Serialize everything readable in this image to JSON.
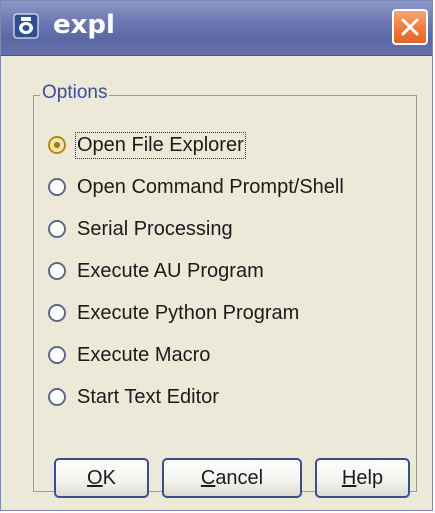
{
  "window": {
    "title": "expl"
  },
  "group": {
    "label": "Options"
  },
  "options": [
    {
      "label": "Open File Explorer",
      "selected": true
    },
    {
      "label": "Open Command Prompt/Shell",
      "selected": false
    },
    {
      "label": "Serial Processing",
      "selected": false
    },
    {
      "label": "Execute AU Program",
      "selected": false
    },
    {
      "label": "Execute Python Program",
      "selected": false
    },
    {
      "label": "Execute Macro",
      "selected": false
    },
    {
      "label": "Start Text Editor",
      "selected": false
    }
  ],
  "buttons": {
    "ok": {
      "mnemonic": "O",
      "rest": "K"
    },
    "cancel": {
      "mnemonic": "C",
      "rest": "ancel"
    },
    "help": {
      "mnemonic": "H",
      "rest": "elp"
    }
  },
  "icons": {
    "app": "app-logo-icon",
    "close": "close-icon"
  },
  "colors": {
    "titlebar": "#6f7bb3",
    "close_button": "#ef7a3b",
    "group_label": "#3a4ea0",
    "selected_radio": "#e6d17a"
  }
}
